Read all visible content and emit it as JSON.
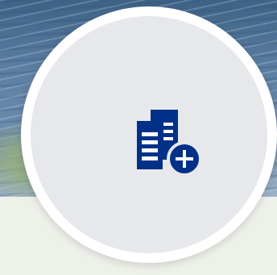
{
  "profile": {
    "avatar_icon": "buildings-add-icon",
    "colors": {
      "icon": "#003087",
      "avatar_background": "#e7e8eb",
      "ring": "#ffffff",
      "panel": "#eef0ea"
    }
  }
}
